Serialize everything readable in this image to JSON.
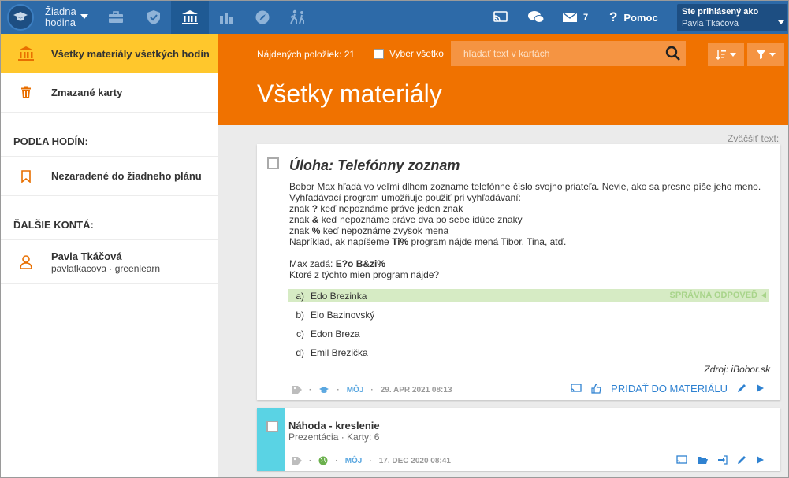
{
  "topbar": {
    "lesson_line1": "Žiadna",
    "lesson_line2": "hodina",
    "messages_count": "7",
    "help_label": "Pomoc",
    "logged_in_label": "Ste prihlásený ako",
    "user_name": "Pavla Tkáčová"
  },
  "sidebar": {
    "all_materials": "Všetky materiály všetkých hodín",
    "deleted_cards": "Zmazané karty",
    "by_lessons_heading": "PODĽA HODÍN:",
    "unassigned": "Nezaradené do žiadneho plánu",
    "other_accounts_heading": "ĎALŠIE KONTÁ:",
    "account_name": "Pavla Tkáčová",
    "account_sub": "pavlatkacova · greenlearn"
  },
  "header": {
    "found_label": "Nájdených položiek: 21",
    "select_all": "Vyber všetko",
    "search_placeholder": "hľadať text v kartách",
    "title": "Všetky materiály"
  },
  "zoom_label": "Zväčšiť text:",
  "card1": {
    "title": "Úloha: Telefónny zoznam",
    "body_lines": [
      "Bobor Max hľadá vo veľmi dlhom zozname telefónne číslo svojho priateľa. Nevie, ako sa presne píše jeho meno.",
      "Vyhľadávací program umožňuje použiť pri vyhľadávaní:"
    ],
    "rule1_sym": "?",
    "rule1_pre": "znak ",
    "rule1_post": " keď nepoznáme práve jeden znak",
    "rule2_sym": "&",
    "rule2_pre": "znak ",
    "rule2_post": " keď nepoznáme práve dva po sebe idúce znaky",
    "rule3_sym": "%",
    "rule3_pre": "znak ",
    "rule3_post": " keď nepoznáme zvyšok mena",
    "example_pre": "Napríklad, ak napíšeme ",
    "example_sym": "Ti%",
    "example_post": " program nájde mená Tibor, Tina, atď.",
    "query_pre": "Max zadá: ",
    "query_sym": "E?o B&zi%",
    "question": "Ktoré z týchto mien program nájde?",
    "answers": [
      {
        "letter": "a)",
        "text": "Edo Brezinka"
      },
      {
        "letter": "b)",
        "text": "Elo Bazinovský"
      },
      {
        "letter": "c)",
        "text": "Edon Breza"
      },
      {
        "letter": "d)",
        "text": "Emil Brezička"
      }
    ],
    "correct_label": "SPRÁVNA ODPOVEĎ",
    "source": "Zdroj: iBobor.sk",
    "owner": "MÔJ",
    "date": "29. APR 2021 08:13",
    "add_label": "PRIDAŤ DO MATERIÁLU"
  },
  "card2": {
    "title": "Náhoda - kreslenie",
    "subtitle": "Prezentácia · Karty: 6",
    "owner": "MÔJ",
    "date": "17. DEC 2020 08:41"
  },
  "colors": {
    "topbar": "#2d6aa8",
    "accent_orange": "#f07200",
    "active_sidebar": "#ffc72c",
    "correct_bg": "#d6ebc4",
    "card2_stripe": "#5ad3e4"
  }
}
